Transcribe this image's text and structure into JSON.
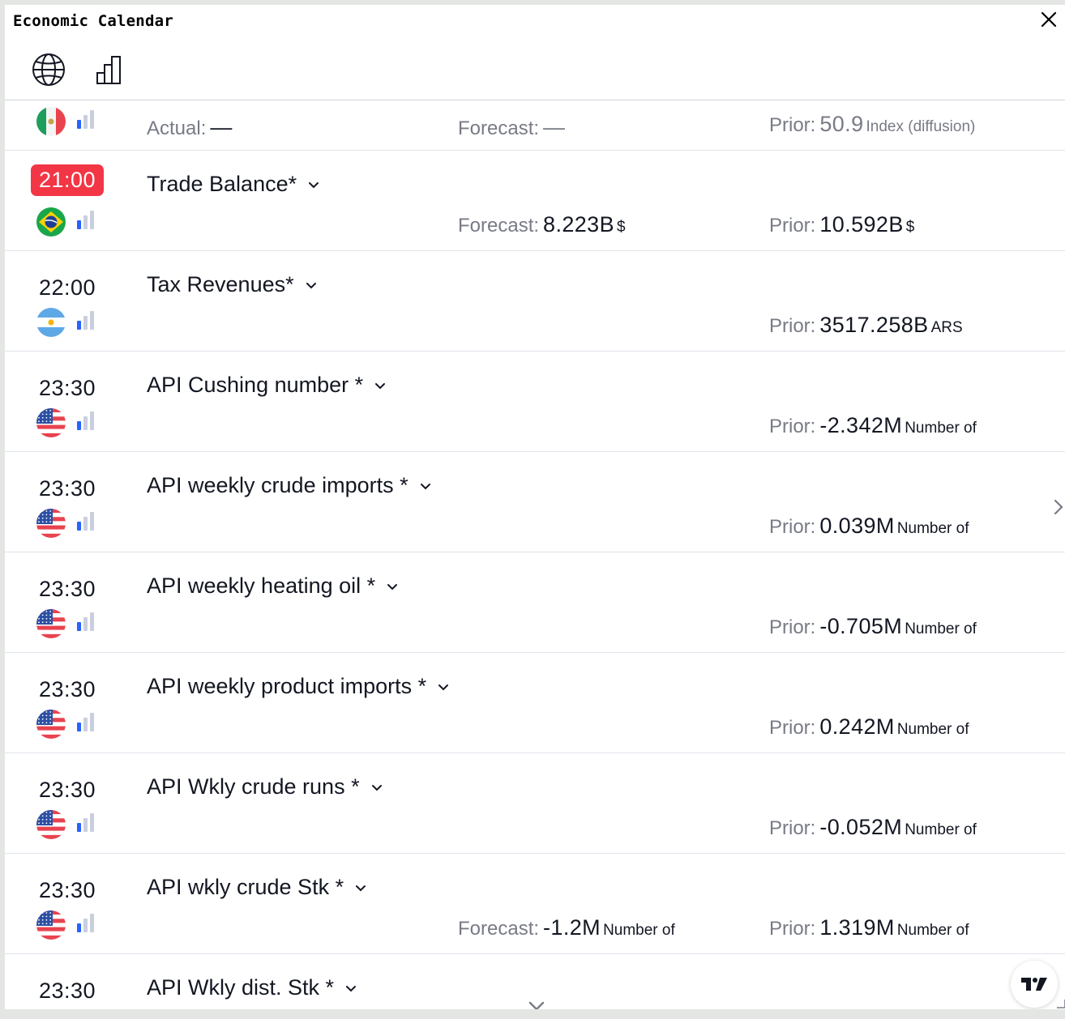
{
  "window": {
    "title": "Economic Calendar"
  },
  "colors": {
    "highlight_time_bg": "#f23645",
    "muted": "#787b86",
    "text": "#131722",
    "importance_active": "#2962ff",
    "importance_inactive": "#c9cfde"
  },
  "labels": {
    "actual": "Actual:",
    "forecast": "Forecast:",
    "prior": "Prior:"
  },
  "partial_row": {
    "country": "Mexico",
    "actual": "—",
    "forecast": "—",
    "prior_value": "50.9",
    "prior_unit": "Index (diffusion)"
  },
  "events": [
    {
      "time": "21:00",
      "highlighted": true,
      "country": "Brazil",
      "name": "Trade Balance*",
      "forecast_value": "8.223B",
      "forecast_unit": "$",
      "prior_value": "10.592B",
      "prior_unit": "$"
    },
    {
      "time": "22:00",
      "country": "Argentina",
      "name": "Tax Revenues*",
      "prior_value": "3517.258B",
      "prior_unit": "ARS"
    },
    {
      "time": "23:30",
      "country": "United States",
      "name": "API Cushing number *",
      "prior_value": "-2.342M",
      "prior_unit": "Number of"
    },
    {
      "time": "23:30",
      "country": "United States",
      "name": "API weekly crude imports *",
      "prior_value": "0.039M",
      "prior_unit": "Number of"
    },
    {
      "time": "23:30",
      "country": "United States",
      "name": "API weekly heating oil *",
      "prior_value": "-0.705M",
      "prior_unit": "Number of"
    },
    {
      "time": "23:30",
      "country": "United States",
      "name": "API weekly product imports *",
      "prior_value": "0.242M",
      "prior_unit": "Number of"
    },
    {
      "time": "23:30",
      "country": "United States",
      "name": "API Wkly crude runs *",
      "prior_value": "-0.052M",
      "prior_unit": "Number of"
    },
    {
      "time": "23:30",
      "country": "United States",
      "name": "API wkly crude Stk *",
      "forecast_value": "-1.2M",
      "forecast_unit": "Number of",
      "prior_value": "1.319M",
      "prior_unit": "Number of"
    },
    {
      "time": "23:30",
      "country": "United States",
      "name": "API Wkly dist. Stk *"
    }
  ],
  "icons": {
    "close": "close-icon",
    "globe": "globe-icon",
    "chart": "bar-chart-icon",
    "chevron": "chevron-down-icon",
    "importance": "importance-bars-icon",
    "tradingview": "tradingview-logo-icon"
  }
}
